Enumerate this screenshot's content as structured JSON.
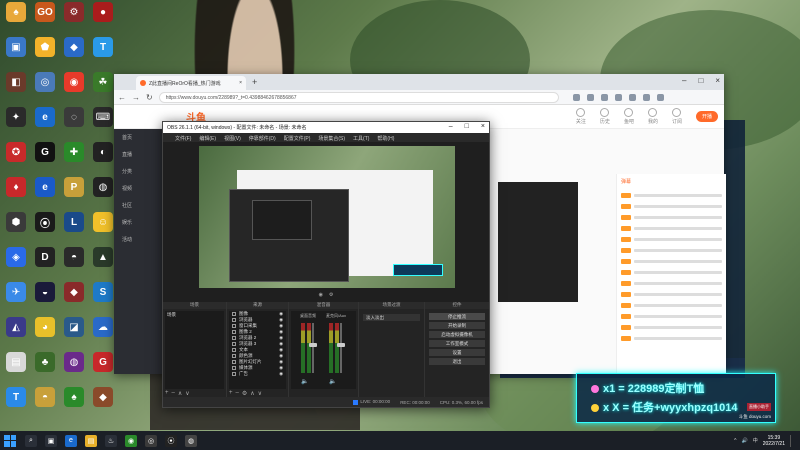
{
  "desktop": {
    "icons": [
      {
        "label": "",
        "color": "#e8a83a",
        "glyph": "♠"
      },
      {
        "label": "",
        "color": "#c8581c",
        "glyph": "GO"
      },
      {
        "label": "",
        "color": "#8a2a2a",
        "glyph": "⚙"
      },
      {
        "label": "",
        "color": "#aa1c1c",
        "glyph": "●"
      },
      {
        "label": "",
        "color": "#3a78c8",
        "glyph": "▣"
      },
      {
        "label": "",
        "color": "#f2b22a",
        "glyph": "⬟"
      },
      {
        "label": "",
        "color": "#2a6ac8",
        "glyph": "◆"
      },
      {
        "label": "",
        "color": "#2a9ae8",
        "glyph": "T"
      },
      {
        "label": "",
        "color": "#6a3a2a",
        "glyph": "◧"
      },
      {
        "label": "",
        "color": "#4a7ab8",
        "glyph": "◎"
      },
      {
        "label": "",
        "color": "#e83a2a",
        "glyph": "◉"
      },
      {
        "label": "",
        "color": "#3a7a2a",
        "glyph": "☘"
      },
      {
        "label": "",
        "color": "#2a2a2a",
        "glyph": "✦"
      },
      {
        "label": "",
        "color": "#1a6acc",
        "glyph": "e"
      },
      {
        "label": "",
        "color": "#3a3a3a",
        "glyph": "◌"
      },
      {
        "label": "",
        "color": "#2a2a2a",
        "glyph": "⌨"
      },
      {
        "label": "",
        "color": "#c82a2a",
        "glyph": "✪"
      },
      {
        "label": "",
        "color": "#111111",
        "glyph": "G"
      },
      {
        "label": "",
        "color": "#2a8a2a",
        "glyph": "✚"
      },
      {
        "label": "",
        "color": "#222222",
        "glyph": "◐"
      },
      {
        "label": "",
        "color": "#c8282a",
        "glyph": "♦"
      },
      {
        "label": "",
        "color": "#1a5ac8",
        "glyph": "e"
      },
      {
        "label": "",
        "color": "#c8a03a",
        "glyph": "P"
      },
      {
        "label": "",
        "color": "#222222",
        "glyph": "◍"
      },
      {
        "label": "",
        "color": "#3a3a3a",
        "glyph": "⬢"
      },
      {
        "label": "",
        "color": "#1a1a1a",
        "glyph": "⦿"
      },
      {
        "label": "",
        "color": "#1a4a8a",
        "glyph": "L"
      },
      {
        "label": "",
        "color": "#f0c02a",
        "glyph": "☺"
      },
      {
        "label": "",
        "color": "#2a6ae8",
        "glyph": "◈"
      },
      {
        "label": "",
        "color": "#222222",
        "glyph": "D"
      },
      {
        "label": "",
        "color": "#2a2a2a",
        "glyph": "◓"
      },
      {
        "label": "",
        "color": "#2a3a2a",
        "glyph": "▲"
      },
      {
        "label": "",
        "color": "#3a8ae8",
        "glyph": "✈"
      },
      {
        "label": "",
        "color": "#1a1a3a",
        "glyph": "◒"
      },
      {
        "label": "",
        "color": "#8a2a2a",
        "glyph": "◆"
      },
      {
        "label": "",
        "color": "#1e7ac8",
        "glyph": "S"
      },
      {
        "label": "",
        "color": "#3a3a8a",
        "glyph": "◭"
      },
      {
        "label": "",
        "color": "#e8c02a",
        "glyph": "◕"
      },
      {
        "label": "",
        "color": "#2a5a8a",
        "glyph": "◪"
      },
      {
        "label": "",
        "color": "#2a6ac8",
        "glyph": "☁"
      },
      {
        "label": "",
        "color": "#d8d8d8",
        "glyph": "▤"
      },
      {
        "label": "",
        "color": "#3a6a2a",
        "glyph": "♣"
      },
      {
        "label": "",
        "color": "#6a2a8a",
        "glyph": "◍"
      },
      {
        "label": "",
        "color": "#c8282a",
        "glyph": "G"
      },
      {
        "label": "",
        "color": "#2a8ae8",
        "glyph": "T"
      },
      {
        "label": "",
        "color": "#c8a03a",
        "glyph": "◓"
      },
      {
        "label": "",
        "color": "#2a8a2a",
        "glyph": "♠"
      },
      {
        "label": "",
        "color": "#8a4a2a",
        "glyph": "◆"
      }
    ]
  },
  "browser": {
    "tab_label": "Z此直播间ReOrO看播_热门游戏",
    "new_tab": "+",
    "url": "https://www.douyu.com/228989?_t=0.43988462678856867",
    "nav": [
      "←",
      "→",
      "↻"
    ],
    "win_controls": [
      "–",
      "□",
      "×"
    ]
  },
  "site": {
    "logo": "斗鱼",
    "nav_items": [
      "首页",
      "直播",
      "分类",
      "视频",
      "社区",
      "娱乐",
      "活动"
    ],
    "header_right": [
      "关注",
      "历史",
      "鱼吧",
      "我的",
      "订阅"
    ],
    "cta": "开播",
    "chat_tab": "弹幕",
    "chat_rows": 14
  },
  "obs": {
    "title": "OBS 26.1.1 (64-bit, windows) - 配置文件: 未命名 - 场景: 未命名",
    "menu": [
      "文件(F)",
      "编辑(E)",
      "视图(V)",
      "停靠部件(D)",
      "配置文件(P)",
      "场景集合(S)",
      "工具(T)",
      "帮助(H)"
    ],
    "preview_bar": [
      "◉",
      "⚙"
    ],
    "docks": {
      "scenes": {
        "title": "场景",
        "items": [
          "场景"
        ]
      },
      "sources": {
        "title": "来源",
        "items": [
          "图像",
          "浏览器",
          "窗口采集",
          "图像 2",
          "浏览器 2",
          "浏览器 3",
          "文本",
          "颜色源",
          "图片幻灯片",
          "媒体源",
          "广告"
        ]
      },
      "mixer": {
        "title": "混音器",
        "channels": [
          "桌面音频",
          "麦克风/Aux"
        ]
      },
      "transitions": {
        "title": "场景过渡",
        "selected": "淡入淡出"
      },
      "controls": {
        "title": "控件",
        "buttons": [
          "停止推流",
          "开始录制",
          "启动虚拟摄像机",
          "工作室模式",
          "设置",
          "退出"
        ]
      }
    },
    "status": {
      "live": "LIVE: 00:00:00",
      "rec": "REC: 00:00:00",
      "cpu": "CPU: 0.3%, 60.00 fps"
    },
    "controls_win": [
      "–",
      "□",
      "×"
    ]
  },
  "overlay": {
    "line1": "x1 = 228989定制T恤",
    "line2": "x X = 任务+wyyxhpzq1014",
    "tag": "直播小助手",
    "watermark": "斗鱼 douyu.com"
  },
  "taskbar": {
    "icons": [
      {
        "glyph": "⌕",
        "color": "#2a2f38"
      },
      {
        "glyph": "▣",
        "color": "#2a2f38"
      },
      {
        "glyph": "e",
        "color": "#1a6acc"
      },
      {
        "glyph": "▤",
        "color": "#e8b02a"
      },
      {
        "glyph": "♨",
        "color": "#2a2f38"
      },
      {
        "glyph": "◉",
        "color": "#2a8a2a"
      },
      {
        "glyph": "◎",
        "color": "#3a3a3a"
      },
      {
        "glyph": "⦿",
        "color": "#222222"
      },
      {
        "glyph": "◍",
        "color": "#444444"
      }
    ],
    "tray": [
      "^",
      "🔊",
      "中"
    ],
    "time": "15:39",
    "date": "2022/7/21"
  }
}
